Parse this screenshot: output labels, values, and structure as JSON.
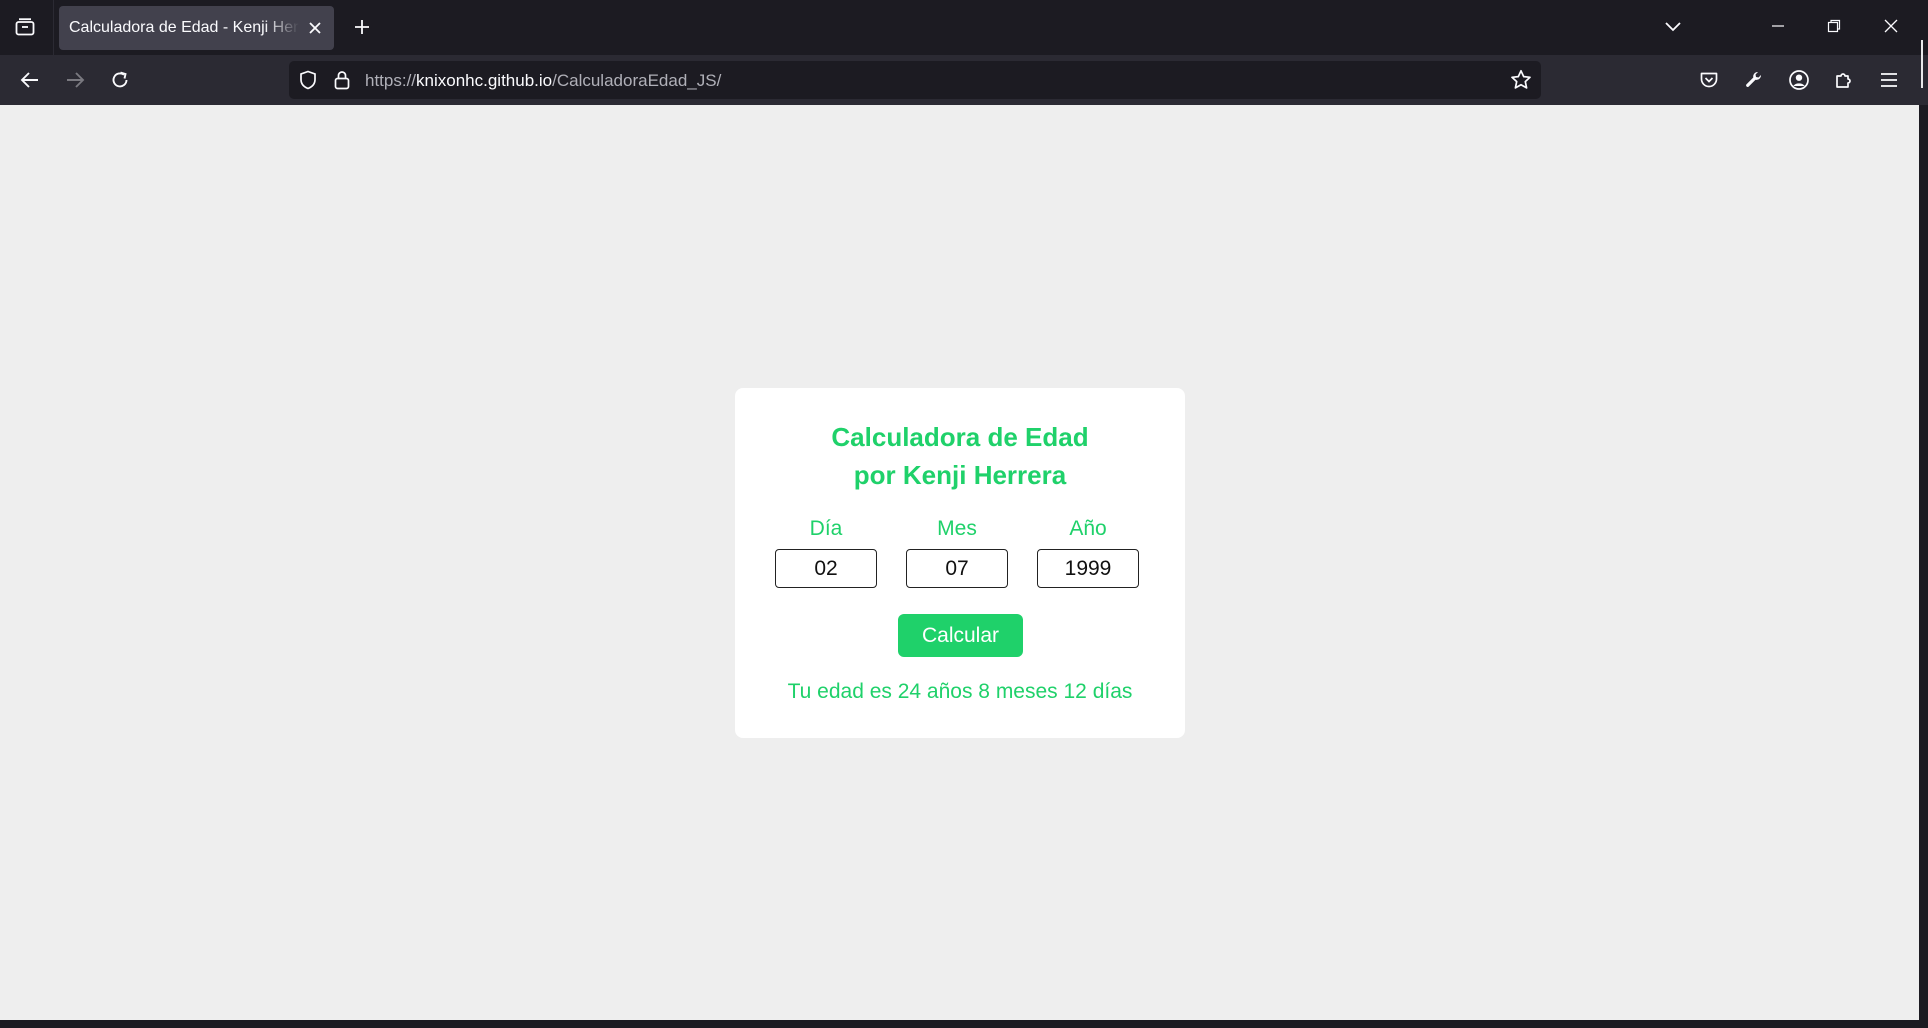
{
  "browser": {
    "tab": {
      "title": "Calculadora de Edad - Kenji Herrera"
    },
    "url": {
      "scheme": "https://",
      "host": "knixonhc.github.io",
      "path": "/CalculadoraEdad_JS/"
    }
  },
  "app": {
    "title_line1": "Calculadora de Edad",
    "title_line2": "por Kenji Herrera",
    "fields": {
      "day": {
        "label": "Día",
        "value": "02"
      },
      "month": {
        "label": "Mes",
        "value": "07"
      },
      "year": {
        "label": "Año",
        "value": "1999"
      }
    },
    "calculate_label": "Calcular",
    "result": "Tu edad es 24 años 8 meses 12 días"
  },
  "colors": {
    "accent": "#1fd16a",
    "page_bg": "#eeeeee",
    "chrome_dark": "#1c1b22",
    "chrome_nav": "#2b2a33"
  },
  "icons": [
    "tab-list-icon",
    "close-icon",
    "plus-icon",
    "chevron-down-icon",
    "minimize-icon",
    "restore-icon",
    "window-close-icon",
    "back-arrow-icon",
    "forward-arrow-icon",
    "reload-icon",
    "shield-icon",
    "lock-icon",
    "star-icon",
    "pocket-icon",
    "wrench-icon",
    "account-icon",
    "extensions-icon",
    "menu-icon"
  ]
}
